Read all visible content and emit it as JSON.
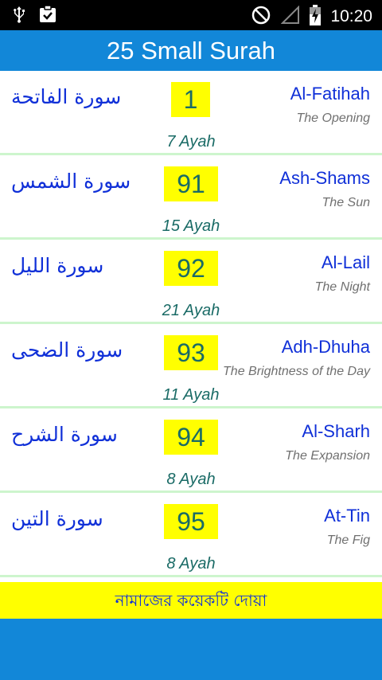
{
  "status_bar": {
    "time": "10:20",
    "icons": [
      "usb-icon",
      "clipboard-check-icon",
      "no-sim-icon",
      "signal-empty-icon",
      "battery-charging-icon"
    ]
  },
  "app_bar": {
    "title": "25 Small Surah"
  },
  "surahs": [
    {
      "arabic": "سورة الفاتحة",
      "number": "1",
      "name": "Al-Fatihah",
      "translation": "The Opening",
      "ayah": "7 Ayah"
    },
    {
      "arabic": "سورة الشمس",
      "number": "91",
      "name": "Ash-Shams",
      "translation": "The Sun",
      "ayah": "15 Ayah"
    },
    {
      "arabic": "سورة الليل",
      "number": "92",
      "name": "Al-Lail",
      "translation": "The Night",
      "ayah": "21 Ayah"
    },
    {
      "arabic": "سورة الضحى",
      "number": "93",
      "name": "Adh-Dhuha",
      "translation": "The Brightness of the Day",
      "ayah": "11 Ayah"
    },
    {
      "arabic": "سورة الشرح",
      "number": "94",
      "name": "Al-Sharh",
      "translation": "The Expansion",
      "ayah": "8 Ayah"
    },
    {
      "arabic": "سورة التين",
      "number": "95",
      "name": "At-Tin",
      "translation": "The Fig",
      "ayah": "8 Ayah"
    }
  ],
  "banner": {
    "text": "নামাজের কয়েকটি দোয়া"
  },
  "colors": {
    "app_bar": "#1287d8",
    "highlight": "#ffff00",
    "arabic_text": "#1030d8",
    "number_text": "#1a6b66",
    "divider": "#cdf5cd"
  }
}
